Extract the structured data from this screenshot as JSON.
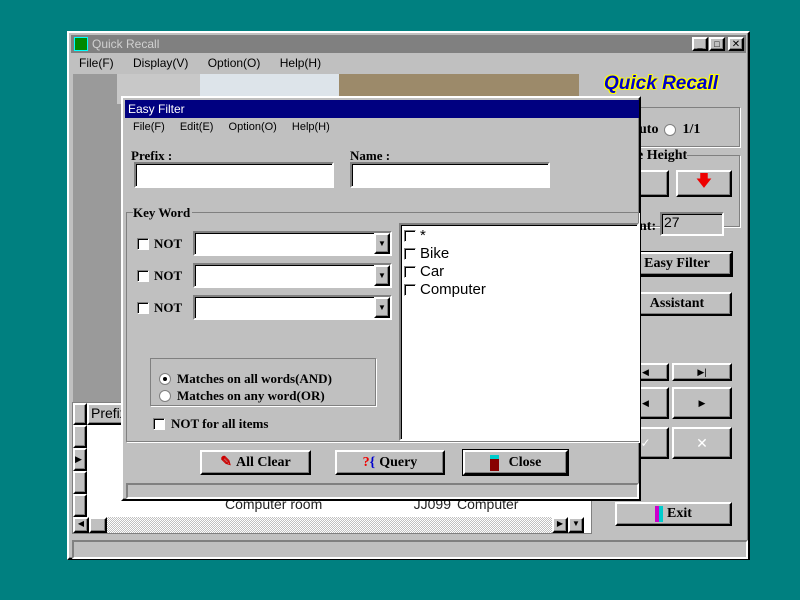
{
  "main": {
    "title": "Quick Recall",
    "menu": [
      "File(F)",
      "Display(V)",
      "Option(O)",
      "Help(H)"
    ],
    "logo": "Quick Recall",
    "radio_auto": "uto",
    "radio_1_1": "1/1",
    "height_label": "e Height",
    "count_label": "nt:",
    "count_value": "27",
    "easy_filter": "Easy Filter",
    "assistant": "Assistant",
    "exit": "Exit",
    "grid": {
      "header": "Prefix",
      "last_row": [
        "Computer room",
        "JJ099",
        "Computer"
      ]
    }
  },
  "dialog": {
    "title": "Easy Filter",
    "menu": [
      "File(F)",
      "Edit(E)",
      "Option(O)",
      "Help(H)"
    ],
    "prefix_label": "Prefix :",
    "name_label": "Name :",
    "prefix_value": "",
    "name_value": "",
    "keyword_label": "Key Word",
    "not_label": "NOT",
    "keywords": [
      "*",
      "Bike",
      "Car",
      "Computer"
    ],
    "match_and": "Matches on all words(AND)",
    "match_or": "Matches on any word(OR)",
    "match_selected": "AND",
    "not_all": "NOT for all items",
    "all_clear": "All Clear",
    "query": "Query",
    "close": "Close"
  },
  "colors": {
    "desktop": "#008080",
    "active_title": "#000080",
    "inactive_title": "#808080",
    "logo": "#0000cc"
  }
}
